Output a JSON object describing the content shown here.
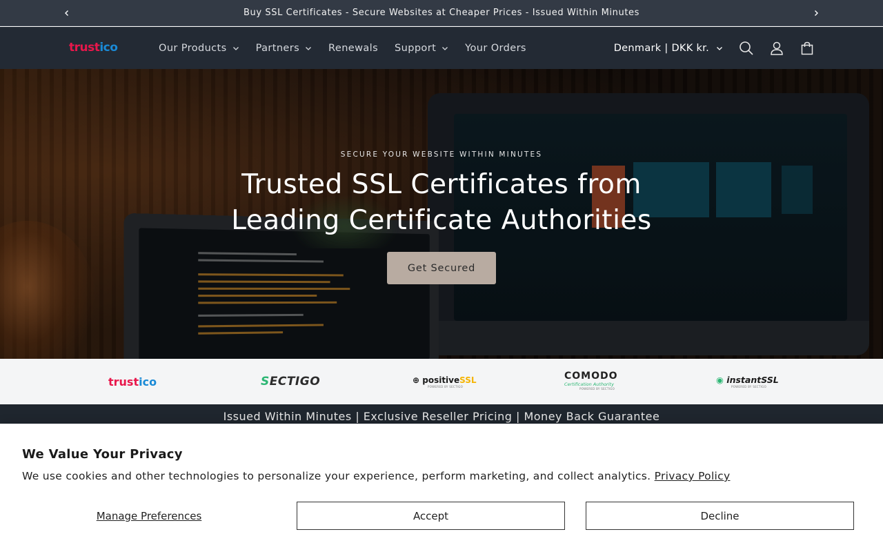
{
  "announcement": {
    "message": "Buy SSL Certificates - Secure Websites at Cheaper Prices - Issued Within Minutes",
    "prev_icon": "chevron-left-icon",
    "next_icon": "chevron-right-icon"
  },
  "header": {
    "logo": {
      "part1": "trust",
      "part2": "ico"
    },
    "nav": [
      {
        "label": "Our Products",
        "has_dropdown": true
      },
      {
        "label": "Partners",
        "has_dropdown": true
      },
      {
        "label": "Renewals",
        "has_dropdown": false
      },
      {
        "label": "Support",
        "has_dropdown": true
      },
      {
        "label": "Your Orders",
        "has_dropdown": false
      }
    ],
    "country_selector": "Denmark | DKK kr.",
    "icons": [
      "search-icon",
      "account-icon",
      "cart-icon"
    ]
  },
  "hero": {
    "eyebrow": "SECURE YOUR WEBSITE WITHIN MINUTES",
    "title": "Trusted SSL Certificates from Leading Certificate Authorities",
    "cta_label": "Get Secured",
    "cta_color": "#b8aba1"
  },
  "brands": {
    "trustico": {
      "part1": "trust",
      "part2": "ico"
    },
    "sectigo": {
      "mark": "S",
      "rest": "ECTIGO"
    },
    "positivessl": {
      "prefix": "positive",
      "suffix": "SSL",
      "sub": "POWERED BY SECTIGO"
    },
    "comodo": {
      "name": "COMODO",
      "sub": "Certification Authority",
      "sub2": "POWERED BY SECTIGO"
    },
    "instantssl": {
      "prefix": "instant",
      "suffix": "SSL",
      "sub": "POWERED BY SECTIGO"
    }
  },
  "tagline": "Issued Within Minutes | Exclusive Reseller Pricing | Money Back Guarantee",
  "cookie": {
    "title": "We Value Your Privacy",
    "text": "We use cookies and other technologies to personalize your experience, perform marketing, and collect analytics.",
    "policy_link": "Privacy Policy",
    "manage_label": "Manage Preferences",
    "accept_label": "Accept",
    "decline_label": "Decline"
  },
  "colors": {
    "announcement_bg": "#333a45",
    "header_bg": "#232a34",
    "brand_red": "#e8174b",
    "brand_blue": "#1a8ad6"
  }
}
